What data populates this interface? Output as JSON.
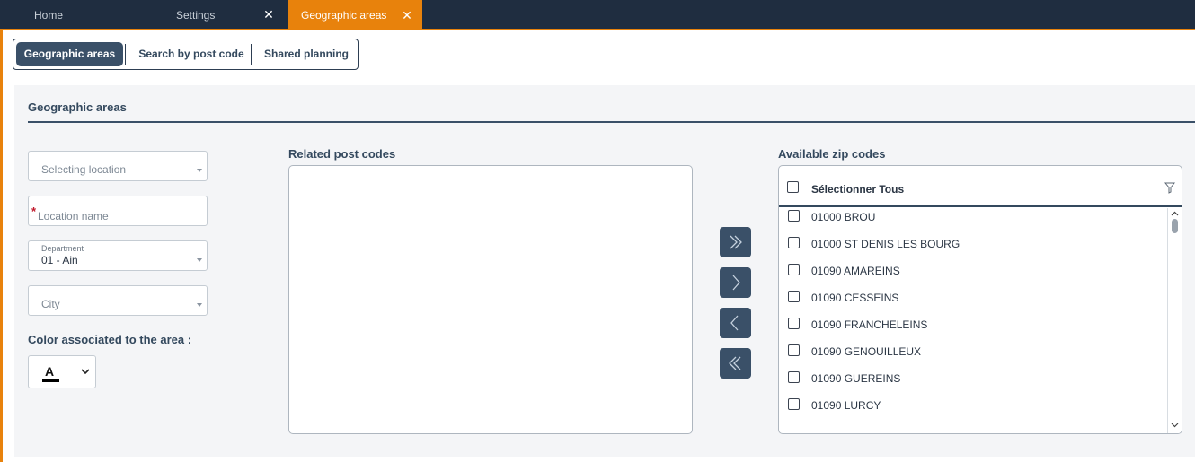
{
  "tabs": {
    "home": "Home",
    "settings": "Settings",
    "active": "Geographic areas",
    "close_glyph": "✕"
  },
  "subnav": {
    "items": [
      "Geographic areas",
      "Search by post code",
      "Shared planning"
    ],
    "active_index": 0
  },
  "section": {
    "title": "Geographic areas"
  },
  "form": {
    "location_select_placeholder": "Selecting location",
    "location_name_placeholder": "Location name",
    "required_mark": "*",
    "department_label": "Department",
    "department_value": "01  - Ain",
    "city_placeholder": "City",
    "color_label": "Color associated to the area :",
    "color_glyph": "A",
    "color_value": "#000000"
  },
  "related": {
    "label": "Related post codes",
    "items": []
  },
  "transfer_buttons": [
    "move-all-right",
    "move-right",
    "move-left",
    "move-all-left"
  ],
  "available": {
    "label": "Available zip codes",
    "select_all": "Sélectionner Tous",
    "items": [
      "01000 BROU",
      "01000 ST DENIS LES BOURG",
      "01090 AMAREINS",
      "01090 CESSEINS",
      "01090 FRANCHELEINS",
      "01090 GENOUILLEUX",
      "01090 GUEREINS",
      "01090 LURCY"
    ]
  },
  "colors": {
    "tabbar": "#1f2d40",
    "accent": "#e8820c",
    "primary": "#3a5068",
    "panel": "#f4f5f7"
  }
}
